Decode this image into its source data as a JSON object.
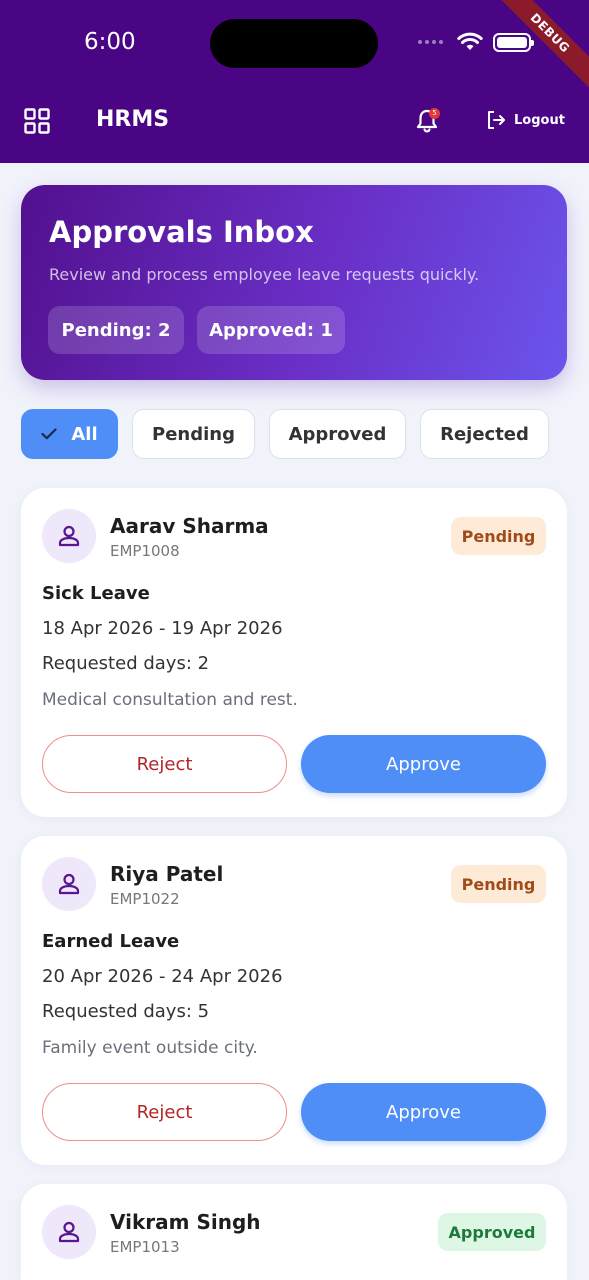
{
  "status_bar": {
    "time": "6:00",
    "debug_label": "DEBUG"
  },
  "app_bar": {
    "title": "HRMS",
    "notification_count": "5",
    "logout_label": "Logout",
    "icons": [
      "grid-menu-icon",
      "bell-icon",
      "logout-icon"
    ]
  },
  "hero": {
    "title": "Approvals Inbox",
    "subtitle": "Review and process employee leave requests quickly.",
    "pending_chip": "Pending: 2",
    "approved_chip": "Approved: 1"
  },
  "filters": [
    {
      "label": "All",
      "active": true
    },
    {
      "label": "Pending",
      "active": false
    },
    {
      "label": "Approved",
      "active": false
    },
    {
      "label": "Rejected",
      "active": false
    }
  ],
  "requests": [
    {
      "name": "Aarav Sharma",
      "emp_id": "EMP1008",
      "status": "Pending",
      "leave_type": "Sick Leave",
      "dates": "18 Apr 2026 - 19 Apr 2026",
      "days": "Requested days: 2",
      "reason": "Medical consultation and rest.",
      "reject_label": "Reject",
      "approve_label": "Approve"
    },
    {
      "name": "Riya Patel",
      "emp_id": "EMP1022",
      "status": "Pending",
      "leave_type": "Earned Leave",
      "dates": "20 Apr 2026 - 24 Apr 2026",
      "days": "Requested days: 5",
      "reason": "Family event outside city.",
      "reject_label": "Reject",
      "approve_label": "Approve"
    },
    {
      "name": "Vikram Singh",
      "emp_id": "EMP1013",
      "status": "Approved"
    }
  ],
  "colors": {
    "app_bar": "#4a0585",
    "accent": "#4f8ef7",
    "pending_bg": "#fdebd8",
    "approved_bg": "#def7e5"
  }
}
